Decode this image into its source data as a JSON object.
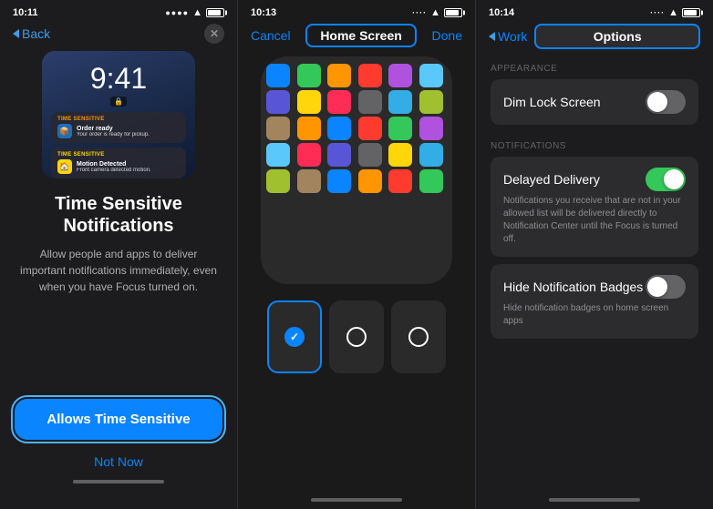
{
  "panel1": {
    "status": {
      "time": "10:11",
      "signal": "●●●●",
      "wifi": "wifi",
      "battery": "75"
    },
    "nav": {
      "back_label": "Back",
      "close_label": "✕"
    },
    "lock_screen": {
      "time": "9:41",
      "badge": "🔒"
    },
    "notifications": [
      {
        "label": "TIME SENSITIVE",
        "label_class": "orange",
        "icon_bg": "blue",
        "icon": "📦",
        "title": "Order ready",
        "body": "Your order is ready for pickup."
      },
      {
        "label": "TIME SENSITIVE",
        "label_class": "yellow",
        "icon_bg": "yellow-bg",
        "icon": "🏠",
        "title": "Motion Detected",
        "body": "Front camera detected motion."
      }
    ],
    "heading": "Time Sensitive Notifications",
    "body": "Allow people and apps to deliver important notifications immediately, even when you have Focus turned on.",
    "allows_btn": "Allows Time Sensitive",
    "not_now_btn": "Not Now"
  },
  "panel2": {
    "status": {
      "time": "10:13"
    },
    "nav": {
      "cancel": "Cancel",
      "title": "Home Screen",
      "done": "Done"
    },
    "thumb_options": [
      {
        "selected": true,
        "checked": true
      },
      {
        "selected": false,
        "checked": false
      },
      {
        "selected": false,
        "checked": false
      }
    ]
  },
  "panel3": {
    "status": {
      "time": "10:14"
    },
    "nav": {
      "back_label": "Work",
      "title": "Options"
    },
    "sections": [
      {
        "label": "APPEARANCE",
        "rows": [
          {
            "label": "Dim Lock Screen",
            "desc": "",
            "toggle": "off"
          }
        ]
      },
      {
        "label": "NOTIFICATIONS",
        "rows": [
          {
            "label": "Delayed Delivery",
            "desc": "Notifications you receive that are not in your allowed list will be delivered directly to Notification Center until the Focus is turned off.",
            "toggle": "on"
          },
          {
            "label": "Hide Notification Badges",
            "desc": "Hide notification badges on home screen apps",
            "toggle": "off"
          }
        ]
      }
    ]
  },
  "icons": {
    "chevron_left": "‹",
    "checkmark": "✓"
  }
}
